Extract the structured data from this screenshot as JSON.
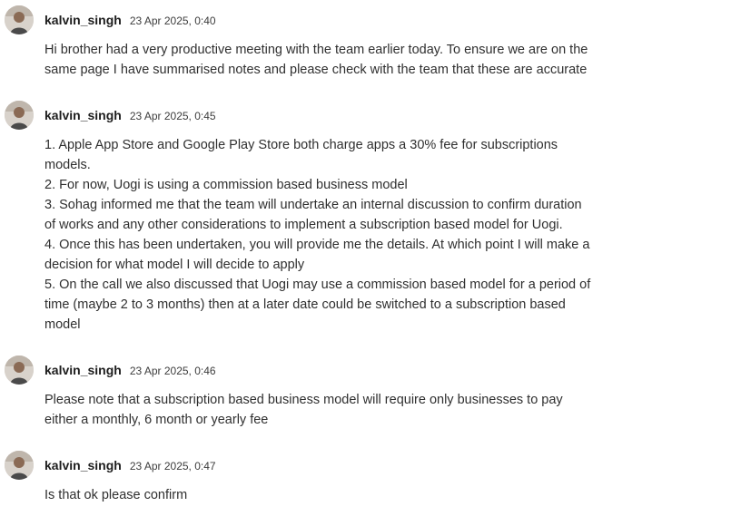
{
  "messages": [
    {
      "username": "kalvin_singh",
      "timestamp": "23 Apr 2025, 0:40",
      "lines": [
        "Hi brother had a very productive meeting with the team earlier today. To ensure we are on the",
        "same page I have summarised notes and please check with the team that these are accurate"
      ]
    },
    {
      "username": "kalvin_singh",
      "timestamp": "23 Apr 2025, 0:45",
      "lines": [
        "1. Apple App Store and Google Play Store both charge apps a 30% fee for subscriptions",
        "models.",
        "2. For now, Uogi is using a commission based business model",
        "3. Sohag informed me that the team will undertake an internal discussion to confirm duration",
        "of works and any other considerations to implement a subscription based model for Uogi.",
        "4. Once this has been undertaken, you will provide me the details. At which point I will make a",
        "decision for what model I will decide to apply",
        "5. On the call we also discussed that Uogi may use a commission based model for a period of",
        "time (maybe 2 to 3 months) then at a later date could be switched to a subscription based",
        "model"
      ]
    },
    {
      "username": "kalvin_singh",
      "timestamp": "23 Apr 2025, 0:46",
      "lines": [
        "Please note that a subscription based business model will require only businesses to pay",
        "either a monthly, 6 month or yearly fee"
      ]
    },
    {
      "username": "kalvin_singh",
      "timestamp": "23 Apr 2025, 0:47",
      "lines": [
        "Is that ok please confirm"
      ]
    }
  ]
}
